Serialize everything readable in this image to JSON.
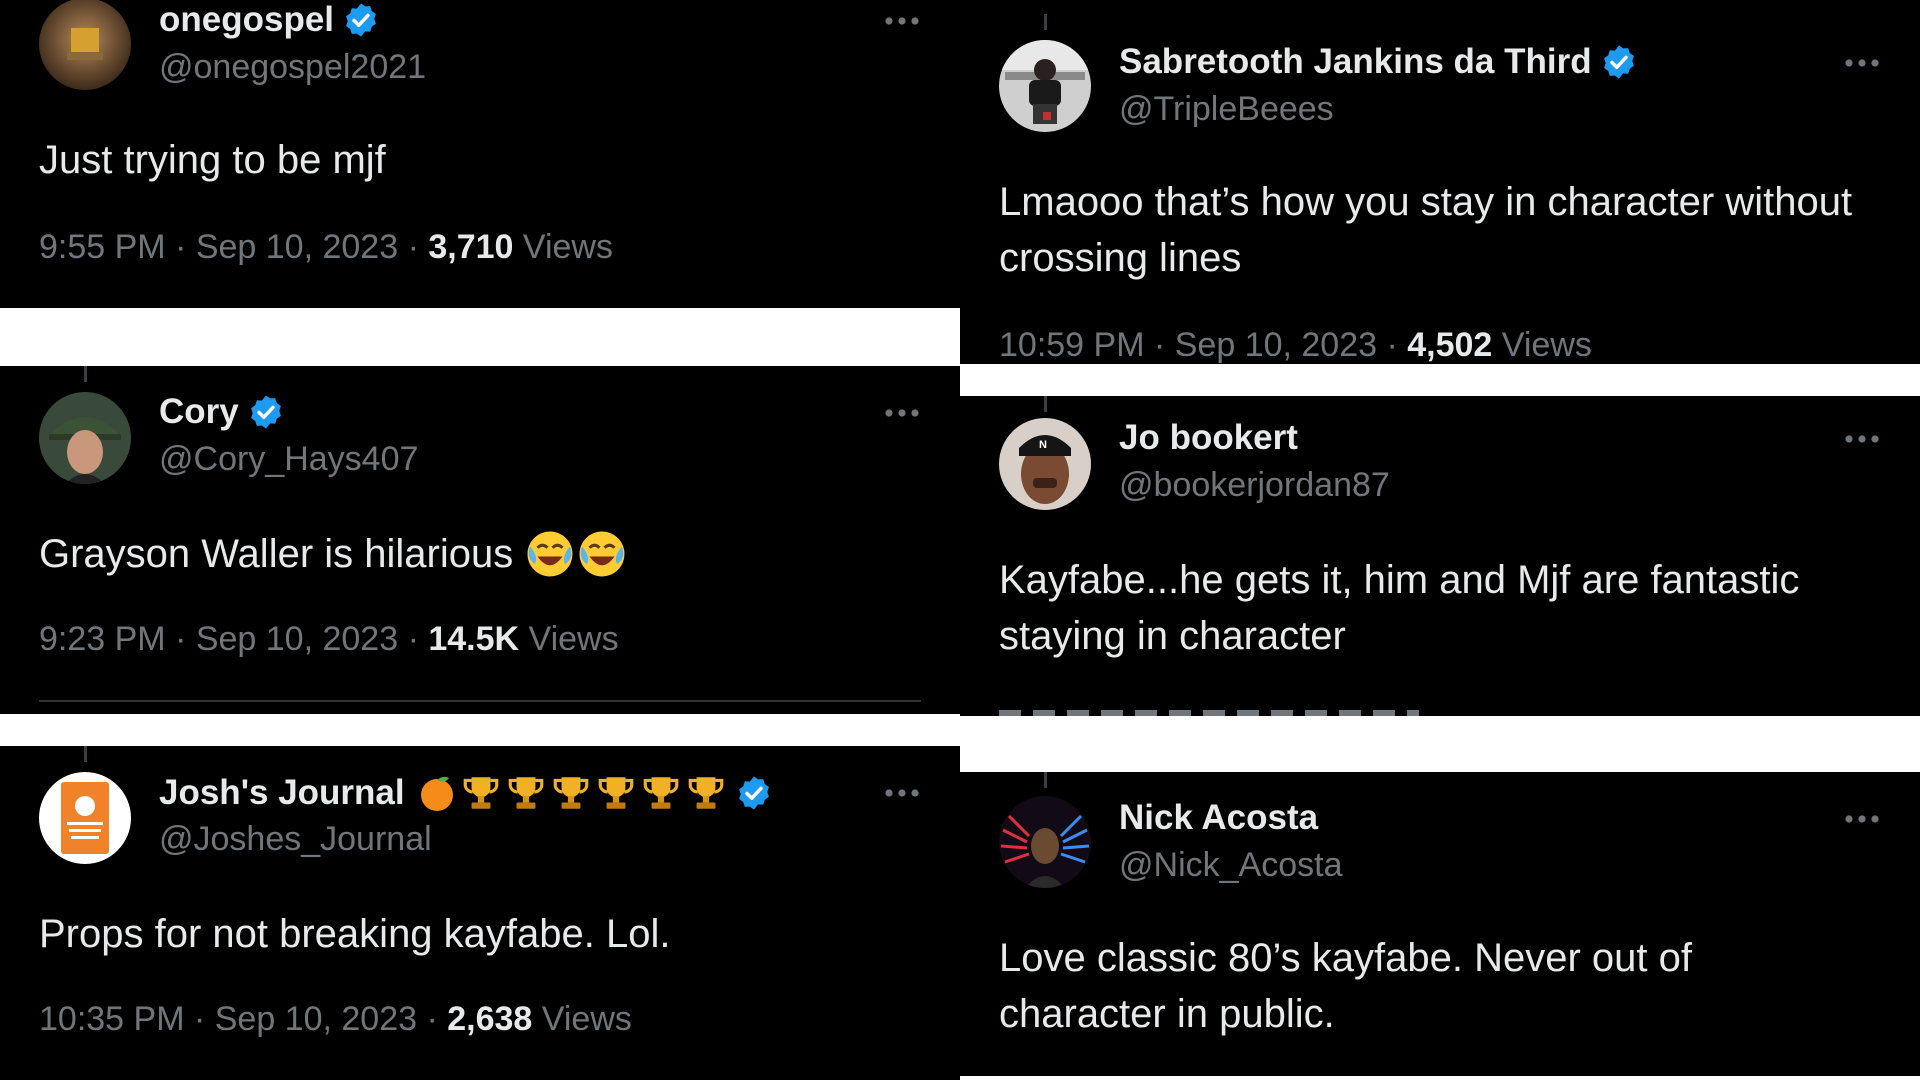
{
  "tweets": [
    {
      "name": "onegospel",
      "handle": "@onegospel2021",
      "text": "Just trying to be mjf",
      "time": "9:55 PM · Sep 10, 2023 · ",
      "views_count": "3,710",
      "views_label": " Views"
    },
    {
      "name": "Sabretooth Jankins da Third",
      "handle": "@TripleBeees",
      "text_lines": [
        "Lmaooo that’s how you stay in character without",
        "crossing lines"
      ],
      "time": "10:59 PM · Sep 10, 2023 · ",
      "views_count": "4,502",
      "views_label": " Views"
    },
    {
      "name": "Cory",
      "handle": "@Cory_Hays407",
      "text": "Grayson Waller is hilarious",
      "time": "9:23 PM · Sep 10, 2023 · ",
      "views_count": "14.5K",
      "views_label": " Views"
    },
    {
      "name": "Jo bookert",
      "handle": "@bookerjordan87",
      "text_lines": [
        "Kayfabe...he gets it, him and Mjf are fantastic",
        "staying in character"
      ]
    },
    {
      "name": "Josh's Journal",
      "handle": "@Joshes_Journal",
      "text": "Props for not breaking kayfabe. Lol.",
      "time": "10:35 PM · Sep 10, 2023 · ",
      "views_count": "2,638",
      "views_label": " Views"
    },
    {
      "name": "Nick Acosta",
      "handle": "@Nick_Acosta",
      "text_lines": [
        "Love classic 80’s kayfabe.  Never out of",
        "character in public."
      ]
    }
  ],
  "icons": {
    "verified_badge": "verified-badge-icon",
    "more": "more-options-icon",
    "laughing_emoji": "face-with-tears-of-joy-emoji",
    "orange_emoji": "orange-emoji",
    "trophy_emoji": "trophy-emoji"
  },
  "colors": {
    "background": "#000000",
    "text_primary": "#e7e9ea",
    "text_secondary": "#71767b",
    "verified_blue": "#1d9bf0",
    "separator": "#ffffff"
  }
}
